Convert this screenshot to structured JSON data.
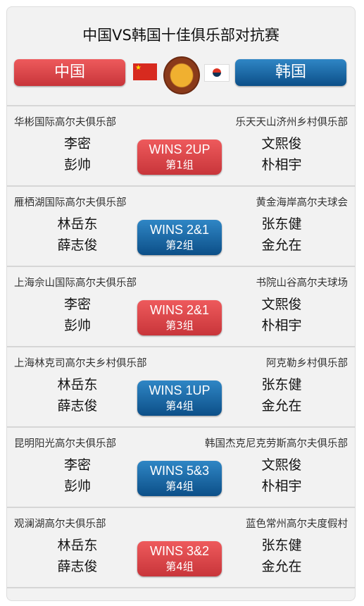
{
  "title": "中国VS韩国十佳俱乐部对抗赛",
  "teams": {
    "left": "中国",
    "right": "韩国"
  },
  "colors": {
    "red": "#d9444a",
    "blue": "#1a64a3"
  },
  "matches": [
    {
      "left_club": "华彬国际高尔夫俱乐部",
      "right_club": "乐天天山济州乡村俱乐部",
      "left_players": [
        "李密",
        "彭帅"
      ],
      "right_players": [
        "文熙俊",
        "朴相宇"
      ],
      "result": "WINS 2UP",
      "group": "第1组",
      "winner": "red"
    },
    {
      "left_club": "雁栖湖国际高尔夫俱乐部",
      "right_club": "黄金海岸高尔夫球会",
      "left_players": [
        "林岳东",
        "薛志俊"
      ],
      "right_players": [
        "张东健",
        "金允在"
      ],
      "result": "WINS 2&1",
      "group": "第2组",
      "winner": "blue"
    },
    {
      "left_club": "上海佘山国际高尔夫俱乐部",
      "right_club": "书院山谷高尔夫球场",
      "left_players": [
        "李密",
        "彭帅"
      ],
      "right_players": [
        "文熙俊",
        "朴相宇"
      ],
      "result": "WINS 2&1",
      "group": "第3组",
      "winner": "red"
    },
    {
      "left_club": "上海林克司高尔夫乡村俱乐部",
      "right_club": "阿克勒乡村俱乐部",
      "left_players": [
        "林岳东",
        "薛志俊"
      ],
      "right_players": [
        "张东健",
        "金允在"
      ],
      "result": "WINS 1UP",
      "group": "第4组",
      "winner": "blue"
    },
    {
      "left_club": "昆明阳光高尔夫俱乐部",
      "right_club": "韩国杰克尼克劳斯高尔夫俱乐部",
      "left_players": [
        "李密",
        "彭帅"
      ],
      "right_players": [
        "文熙俊",
        "朴相宇"
      ],
      "result": "WINS 5&3",
      "group": "第4组",
      "winner": "blue"
    },
    {
      "left_club": "观澜湖高尔夫俱乐部",
      "right_club": "蓝色常州高尔夫度假村",
      "left_players": [
        "林岳东",
        "薛志俊"
      ],
      "right_players": [
        "张东健",
        "金允在"
      ],
      "result": "WINS 3&2",
      "group": "第4组",
      "winner": "red"
    }
  ]
}
